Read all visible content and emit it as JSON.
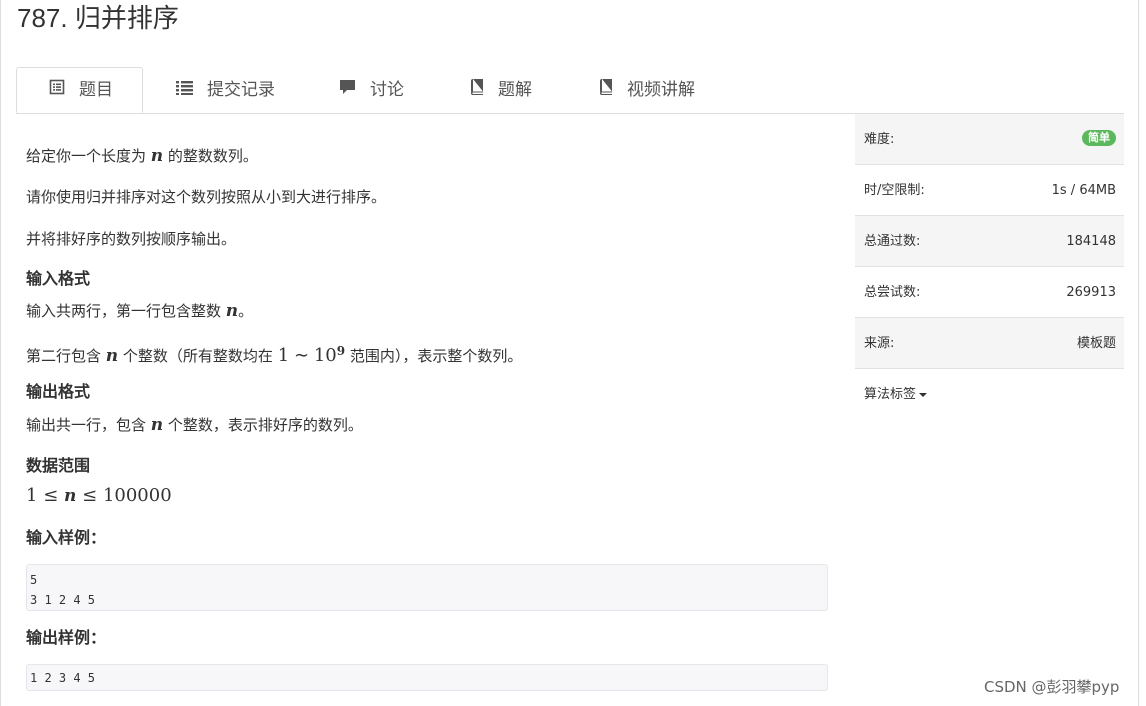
{
  "problem": {
    "title": "787. 归并排序"
  },
  "tabs": [
    {
      "label": "题目",
      "icon": "list-alt-icon",
      "active": true
    },
    {
      "label": "提交记录",
      "icon": "list-icon",
      "active": false
    },
    {
      "label": "讨论",
      "icon": "comment-icon",
      "active": false
    },
    {
      "label": "题解",
      "icon": "book-icon",
      "active": false
    },
    {
      "label": "视频讲解",
      "icon": "book-icon",
      "active": false
    }
  ],
  "statement": {
    "p1_before": "给定你一个长度为 ",
    "p1_var": "n",
    "p1_after": " 的整数数列。",
    "p2": "请你使用归并排序对这个数列按照从小到大进行排序。",
    "p3": "并将排好序的数列按顺序输出。",
    "input_heading": "输入格式",
    "in1_before": "输入共两行，第一行包含整数 ",
    "in1_var": "n",
    "in1_after": "。",
    "in2_before": "第二行包含 ",
    "in2_var": "n",
    "in2_mid": " 个整数（所有整数均在 ",
    "in2_range_lo": "1",
    "in2_tilde": "∼",
    "in2_range_base": "10",
    "in2_range_exp": "9",
    "in2_after": " 范围内），表示整个数列。",
    "output_heading": "输出格式",
    "out_before": "输出共一行，包含 ",
    "out_var": "n",
    "out_after": " 个整数，表示排好序的数列。",
    "range_heading": "数据范围",
    "range_lo": "1",
    "range_le1": "≤",
    "range_var": "n",
    "range_le2": "≤",
    "range_hi": "100000",
    "sample_in_heading": "输入样例：",
    "sample_in": "5\n3 1 2 4 5",
    "sample_out_heading": "输出样例：",
    "sample_out": "1 2 3 4 5"
  },
  "sidebar": {
    "difficulty_label": "难度:",
    "difficulty_value": "简单",
    "difficulty_color": "#5cb85c",
    "limit_label": "时/空限制:",
    "limit_value": "1s / 64MB",
    "accepted_label": "总通过数:",
    "accepted_value": "184148",
    "attempts_label": "总尝试数:",
    "attempts_value": "269913",
    "source_label": "来源:",
    "source_value": "模板题",
    "tags_label": "算法标签"
  },
  "watermark": "CSDN @彭羽攀pyp"
}
